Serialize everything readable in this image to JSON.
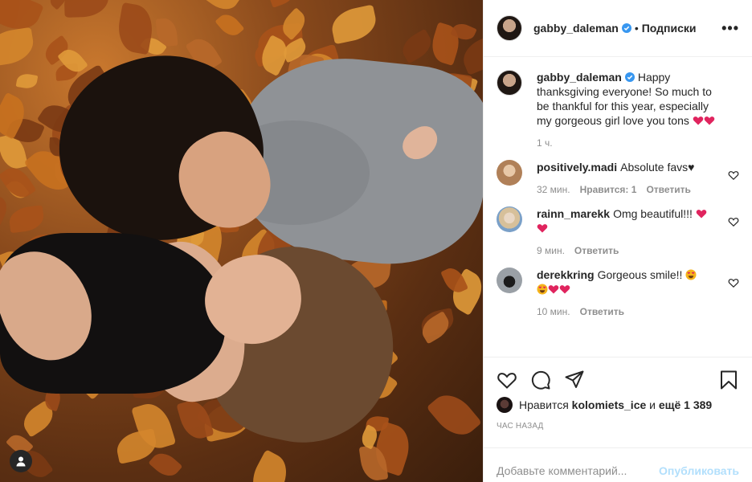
{
  "post": {
    "author": "gabby_daleman",
    "follow_label": "Подписки",
    "more_label": "•••",
    "separator": "•"
  },
  "caption": {
    "username": "gabby_daleman",
    "text": "Happy thanksgiving everyone! So much to be thankful for this year, especially my gorgeous girl love you tons",
    "time": "1 ч."
  },
  "comments": [
    {
      "username": "positively.madi",
      "text": "Absolute favs♥",
      "time": "32 мин.",
      "likes": "Нравится: 1",
      "reply": "Ответить"
    },
    {
      "username": "rainn_marekk",
      "text": "Omg beautiful!!!",
      "time": "9 мин.",
      "reply": "Ответить"
    },
    {
      "username": "derekkring",
      "text": "Gorgeous smile!!",
      "time": "10 мин.",
      "reply": "Ответить"
    }
  ],
  "likes": {
    "prefix": "Нравится",
    "user": "kolomiets_ice",
    "and": "и",
    "more": "ещё 1 389"
  },
  "timestamp": "Час назад",
  "add_comment": {
    "placeholder": "Добавьте комментарий...",
    "post_label": "Опубликовать"
  },
  "colors": {
    "verified": "#3897f0",
    "heart_emoji": "#e0245e",
    "post_button_disabled": "#b2dffc",
    "secondary_text": "#8e8e8e"
  },
  "icons": {
    "like": "heart-outline-icon",
    "comment": "comment-bubble-icon",
    "share": "paper-plane-icon",
    "save": "bookmark-icon",
    "tag": "user-tag-icon",
    "verified": "verified-badge-icon"
  }
}
